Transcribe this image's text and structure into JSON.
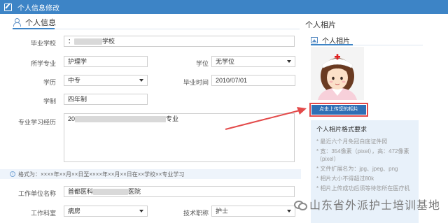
{
  "window": {
    "title": "个人信息修改"
  },
  "section": {
    "title": "个人信息"
  },
  "form": {
    "school_label": "毕业学校",
    "school_value": "：",
    "school_suffix": "学校",
    "major_label": "所学专业",
    "major_value": "护理学",
    "degree_label": "学位",
    "degree_value": "无学位",
    "education_label": "学历",
    "education_value": "中专",
    "grad_time_label": "毕业时间",
    "grad_time_value": "2010/07/01",
    "duration_label": "学制",
    "duration_value": "四年制",
    "experience_label": "专业学习经历",
    "experience_prefix": "20",
    "experience_suffix": "专业",
    "hint_icon": "i",
    "hint_text": "格式为：××××年××月××日至××××年××月××日在××学校××专业学习",
    "employer_label": "工作单位名称",
    "employer_prefix": "首都医科",
    "employer_suffix": "医院",
    "dept_label": "工作科室",
    "dept_value": "病房",
    "title_label": "技术职称",
    "title_value": "护士"
  },
  "photo": {
    "header": "个人相片",
    "subheader": "个人相片",
    "upload_label": "点击上传您的相片"
  },
  "requirements": {
    "title": "个人相片格式要求",
    "items": [
      "* 最近六个月免冠白底证件照",
      "* 宽：354像素（pixel），高：472像素（pixel）",
      "* 文件扩展名为：jpg、jpeg、png",
      "* 相片大小不得超过80k",
      "* 相片上传成功后须等待您所在医疗机"
    ]
  },
  "watermark": {
    "text": "山东省外派护士培训基地"
  },
  "colors": {
    "accent": "#3d84c6",
    "button": "#2f6fb5",
    "highlight": "#e34a4a",
    "panel": "#e8f1fa"
  }
}
